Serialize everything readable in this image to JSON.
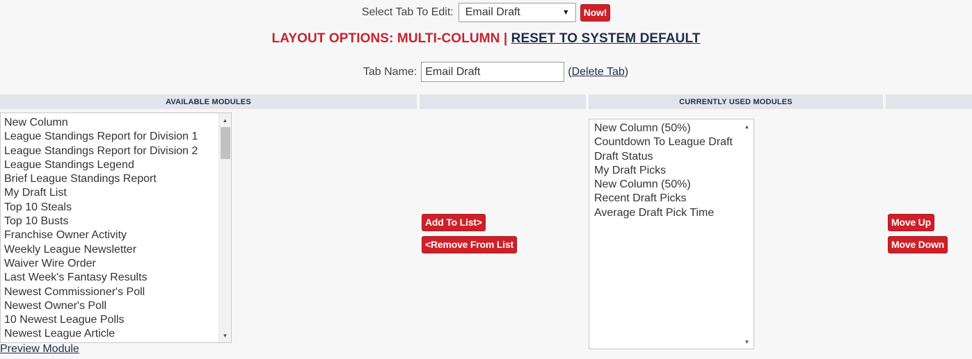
{
  "select_tab": {
    "label": "Select Tab To Edit:",
    "selected": "Email Draft",
    "now_button": "Now!"
  },
  "layout": {
    "label": "LAYOUT OPTIONS: MULTI-COLUMN",
    "separator": "|",
    "reset_link": "RESET TO SYSTEM DEFAULT"
  },
  "tab_name": {
    "label": "Tab Name:",
    "value": "Email Draft",
    "delete_open": "(",
    "delete_link": "Delete Tab",
    "delete_close": ")"
  },
  "headers": {
    "available": "AVAILABLE MODULES",
    "middle": "",
    "current": "CURRENTLY USED MODULES",
    "right": ""
  },
  "available_modules": [
    "New Column",
    "League Standings Report for Division 1",
    "League Standings Report for Division 2",
    "League Standings Legend",
    "Brief League Standings Report",
    "My Draft List",
    "Top 10 Steals",
    "Top 10 Busts",
    "Franchise Owner Activity",
    "Weekly League Newsletter",
    "Waiver Wire Order",
    "Last Week's Fantasy Results",
    "Newest Commissioner's Poll",
    "Newest Owner's Poll",
    "10 Newest League Polls",
    "Newest League Article"
  ],
  "current_modules": [
    "New Column (50%)",
    "Countdown To League Draft",
    "Draft Status",
    "My Draft Picks",
    "New Column (50%)",
    "Recent Draft Picks",
    "Average Draft Pick Time"
  ],
  "buttons": {
    "add": "Add To List>",
    "remove": "<Remove From List",
    "move_up": "Move Up",
    "move_down": "Move Down"
  },
  "preview_link": "Preview Module",
  "colors": {
    "accent_red": "#cd2028",
    "navy": "#1f2d4d",
    "header_bg": "#e1e4ea"
  }
}
